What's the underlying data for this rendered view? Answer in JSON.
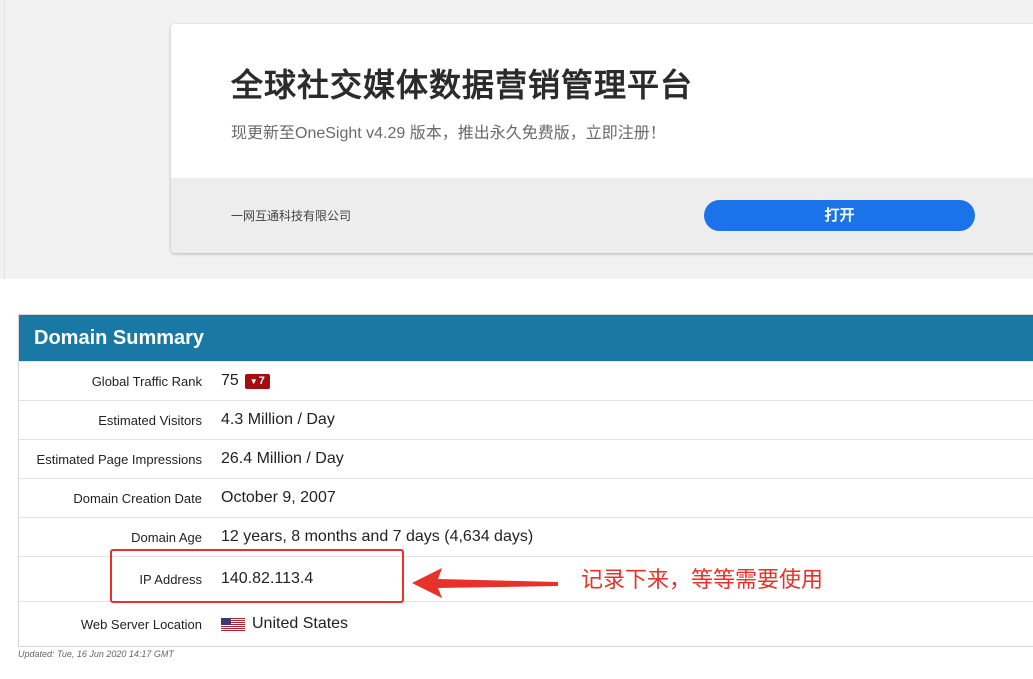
{
  "ad": {
    "title": "全球社交媒体数据营销管理平台",
    "subtitle": "现更新至OneSight v4.29 版本，推出永久免费版，立即注册！",
    "company": "一网互通科技有限公司",
    "open_label": "打开"
  },
  "summary": {
    "title": "Domain Summary",
    "rows": [
      {
        "label": "Global Traffic Rank",
        "value": "75",
        "badge": "7"
      },
      {
        "label": "Estimated Visitors",
        "value": "4.3 Million / Day"
      },
      {
        "label": "Estimated Page Impressions",
        "value": "26.4 Million / Day"
      },
      {
        "label": "Domain Creation Date",
        "value": "October 9, 2007"
      },
      {
        "label": "Domain Age",
        "value": "12 years, 8 months and 7 days (4,634 days)"
      },
      {
        "label": "IP Address",
        "value": "140.82.113.4"
      },
      {
        "label": "Web Server Location",
        "value": "United States",
        "flag_icon": "us-flag-icon"
      }
    ],
    "updated": "Updated: Tue, 16 Jun 2020 14:17 GMT"
  },
  "annotation": {
    "text": "记录下来，等等需要使用"
  },
  "colors": {
    "header_blue": "#1a78a4",
    "button_blue": "#1a73e8",
    "badge_red": "#a40e0e",
    "annotation_red": "#e8312a"
  }
}
